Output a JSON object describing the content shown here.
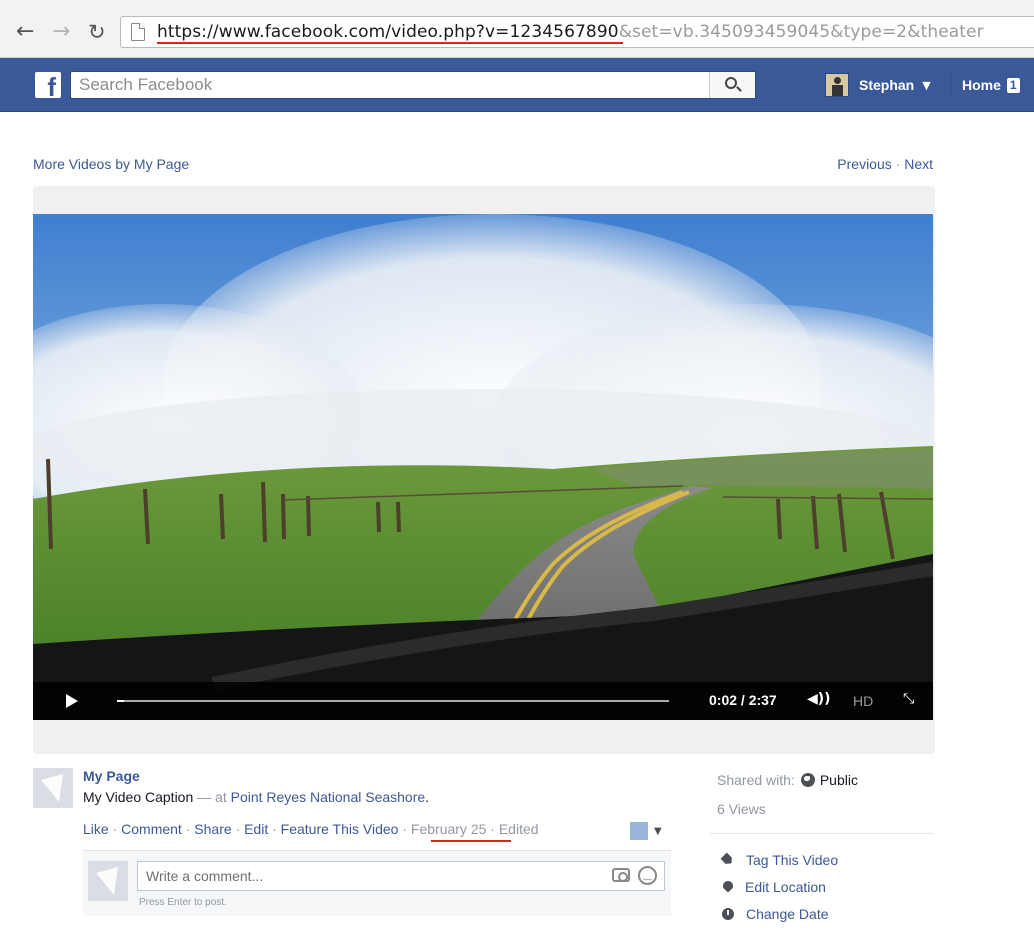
{
  "browser": {
    "url_scheme": "https://",
    "url_host": "www.facebook.com",
    "url_path": "/video.php?v=1234567890",
    "url_query": "&set=vb.345093459045&type=2&theater"
  },
  "fb_bar": {
    "logo": "f",
    "search_placeholder": "Search Facebook",
    "user_name": "Stephan",
    "home_label": "Home",
    "home_count": "1"
  },
  "page": {
    "more_videos_link": "More Videos by My Page",
    "previous_link": "Previous",
    "next_link": "Next",
    "separator": "·"
  },
  "player": {
    "time": "0:02 / 2:37",
    "hd_label": "HD",
    "progress_fraction": 0.013
  },
  "post": {
    "page_name": "My Page",
    "caption": "My Video Caption",
    "dash": "—",
    "at_text": "at",
    "location": "Point Reyes National Seashore",
    "location_period": ".",
    "actions": {
      "like": "Like",
      "comment": "Comment",
      "share": "Share",
      "edit": "Edit",
      "feature": "Feature This Video",
      "date": "February 25",
      "edited": "Edited"
    },
    "comment_placeholder": "Write a comment...",
    "press_enter": "Press Enter to post."
  },
  "sidebar": {
    "shared_with_label": "Shared with:",
    "shared_with_value": "Public",
    "views": "6 Views",
    "actions": [
      {
        "label": "Tag This Video",
        "icon": "tag-icon"
      },
      {
        "label": "Edit Location",
        "icon": "location-pin-icon"
      },
      {
        "label": "Change Date",
        "icon": "clock-icon"
      }
    ]
  },
  "colors": {
    "fb_blue": "#3b5998",
    "link": "#3b5998",
    "annotation_red": "#d9261c"
  }
}
